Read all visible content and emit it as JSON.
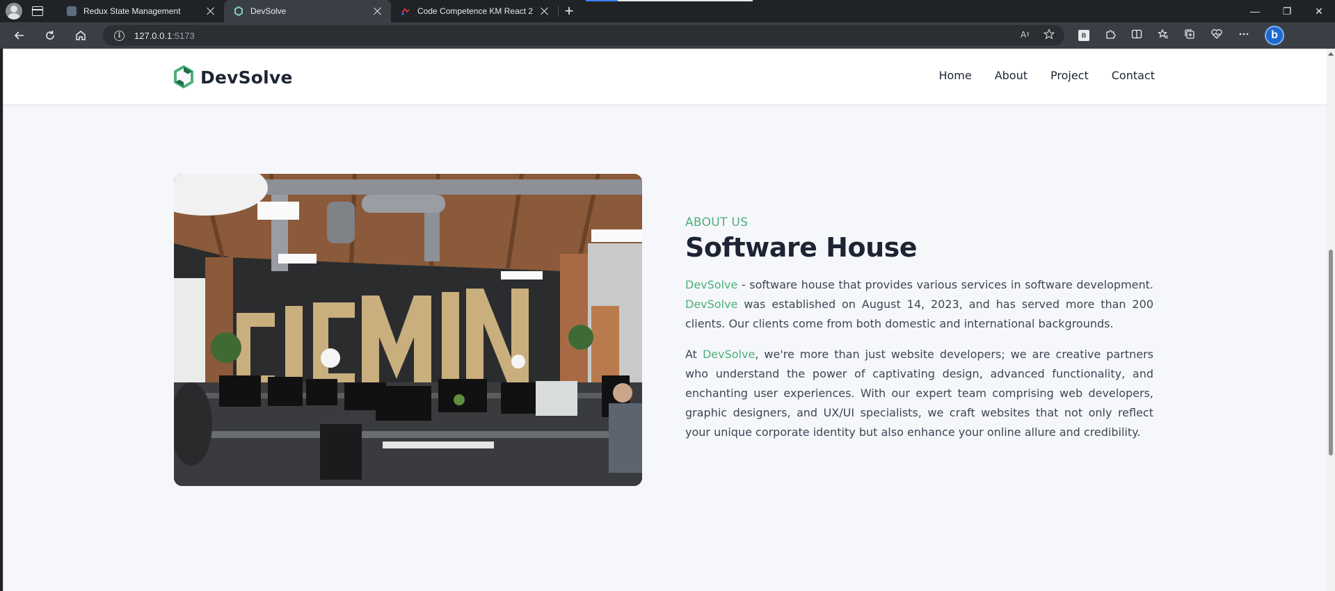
{
  "browser": {
    "tabs": [
      {
        "title": "Redux State Management",
        "active": false,
        "favicon_color": "#5b6e80"
      },
      {
        "title": "DevSolve",
        "active": true,
        "favicon_color": "#5fb3a0"
      },
      {
        "title": "Code Competence KM React 2 -",
        "active": false,
        "favicon_color": "#cc3344"
      }
    ],
    "new_tab_label": "+",
    "window_controls": {
      "minimize": "—",
      "restore": "❐",
      "close": "✕"
    },
    "address": {
      "host": "127.0.0.1",
      "port": ":5173"
    },
    "icons": {
      "back": "back-arrow-icon",
      "reload": "reload-icon",
      "home": "home-icon",
      "info": "info-icon",
      "read_aloud": "read-aloud-icon",
      "favorite": "star-icon",
      "extension": "extension-icon",
      "split": "split-screen-icon",
      "favorites": "favorites-icon",
      "collections": "collections-icon",
      "heart": "browser-essentials-icon",
      "more": "more-icon",
      "bing": "bing-copilot-icon"
    },
    "ext_badge": "B",
    "bing_label": "b",
    "accent": "#1b6ad0"
  },
  "site": {
    "brand": "DevSolve",
    "brand_color": "#4caf7a",
    "nav": [
      "Home",
      "About",
      "Project",
      "Contact"
    ],
    "about": {
      "eyebrow": "ABOUT US",
      "title": "Software House",
      "p1": {
        "a_brand": "DevSolve",
        "a_text": " - software house that provides various services in software development. ",
        "b_brand": "DevSolve",
        "b_text": " was established on August 14, 2023, and has served more than 200 clients. Our clients come from both domestic and international backgrounds."
      },
      "p2": {
        "pre": "At ",
        "brand": "DevSolve",
        "text": ", we're more than just website developers; we are creative partners who understand the power of captivating design, advanced functionality, and enchanting user experiences. With our expert team comprising web developers, graphic designers, and UX/UI specialists, we craft websites that not only reflect your unique corporate identity but also enhance your online allure and credibility."
      },
      "image_alt": "office-photo"
    }
  }
}
